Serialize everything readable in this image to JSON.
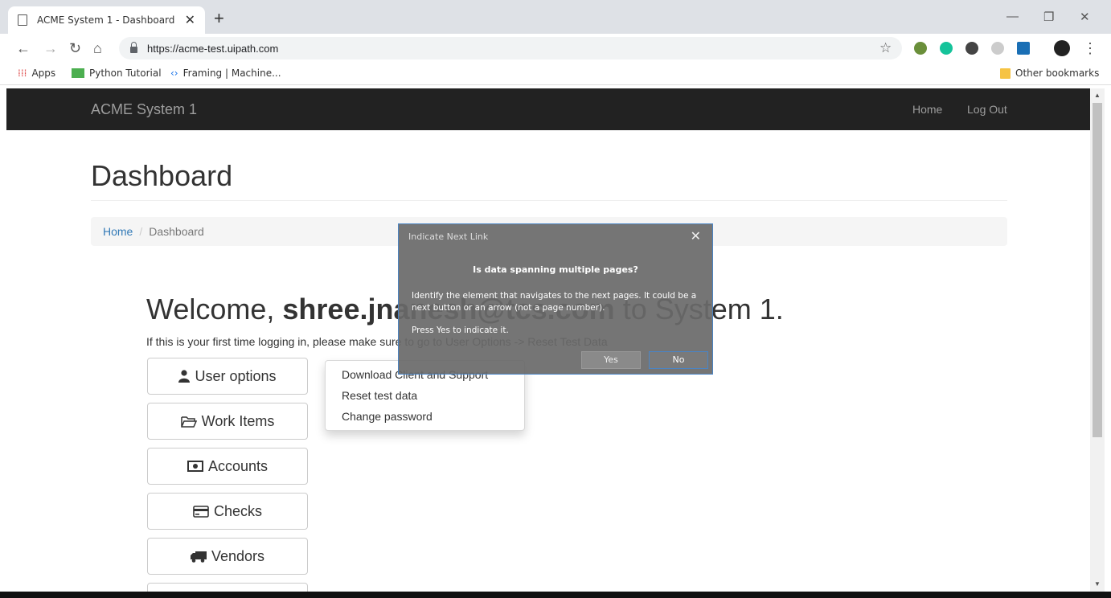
{
  "browser": {
    "tab_title": "ACME System 1 - Dashboard",
    "url": "https://acme-test.uipath.com",
    "bookmarks": {
      "apps": "Apps",
      "python": "Python Tutorial",
      "framing": "Framing | Machine...",
      "other": "Other bookmarks"
    }
  },
  "navbar": {
    "brand": "ACME System 1",
    "home": "Home",
    "logout": "Log Out"
  },
  "page": {
    "title": "Dashboard",
    "breadcrumb": {
      "home": "Home",
      "current": "Dashboard"
    },
    "welcome_prefix": "Welcome,",
    "welcome_user": "shree.jnanesh@tcs.com",
    "welcome_suffix": "to System 1.",
    "note": "If this is your first time logging in, please make sure to go to User Options -> Reset Test Data"
  },
  "buttons": {
    "user_options": "User options",
    "work_items": "Work Items",
    "accounts": "Accounts",
    "checks": "Checks",
    "vendors": "Vendors"
  },
  "menu": {
    "items": [
      "Download Client and Support",
      "Reset test data",
      "Change password"
    ]
  },
  "dialog": {
    "title": "Indicate Next Link",
    "question": "Is data spanning multiple pages?",
    "body": "Identify the element that navigates to the next pages. It could be a next button or an arrow (not a page number).",
    "hint": "Press Yes to indicate it.",
    "yes": "Yes",
    "no": "No"
  },
  "colors": {
    "navbar_bg": "#222222",
    "link": "#337ab7",
    "dialog_border": "#4a84c4"
  }
}
